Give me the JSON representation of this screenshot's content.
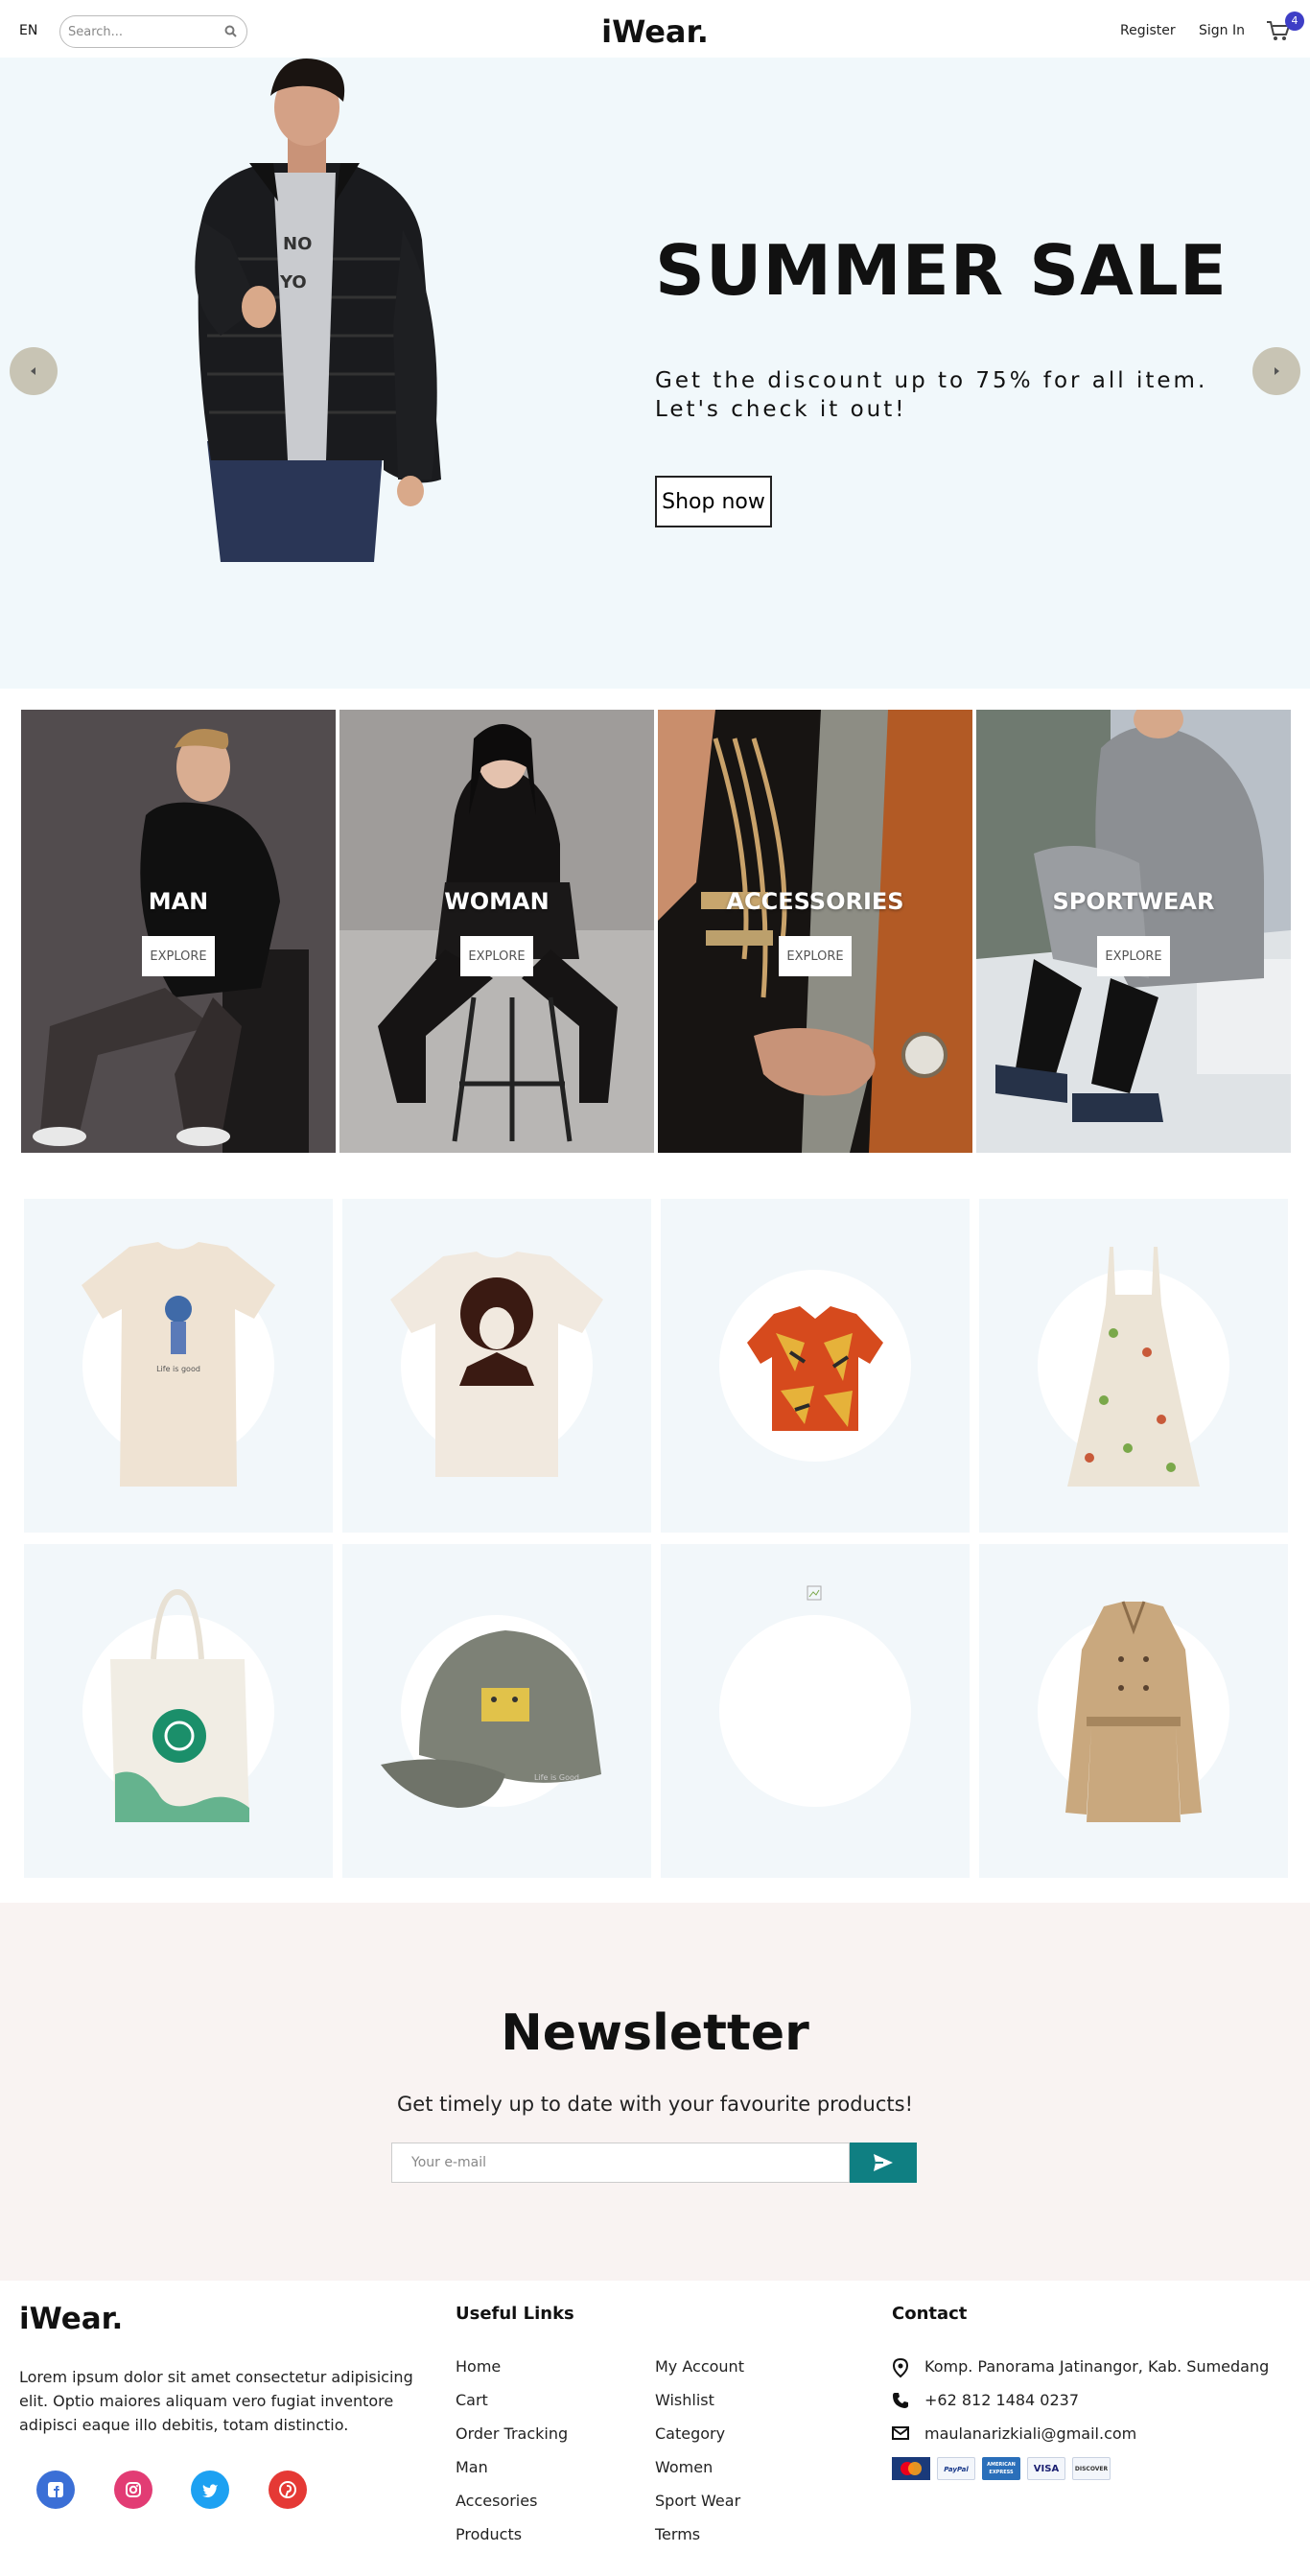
{
  "header": {
    "lang": "EN",
    "search_placeholder": "Search...",
    "logo": "iWear.",
    "register": "Register",
    "signin": "Sign In",
    "cart_count": "4"
  },
  "hero": {
    "title": "SUMMER SALE",
    "subtitle": "Get the discount up to 75% for all item. Let's check it out!",
    "button": "Shop now"
  },
  "categories": [
    {
      "label": "MAN",
      "button": "EXPLORE"
    },
    {
      "label": "WOMAN",
      "button": "EXPLORE"
    },
    {
      "label": "ACCESSORIES",
      "button": "EXPLORE"
    },
    {
      "label": "SPORTWEAR",
      "button": "EXPLORE"
    }
  ],
  "products": [
    "t-shirt-guitar",
    "t-shirt-portrait",
    "hawaiian-shirt",
    "floral-dress",
    "tote-bag",
    "cap",
    "broken-image",
    "trench-coat"
  ],
  "newsletter": {
    "title": "Newsletter",
    "subtitle": "Get timely up to date with your favourite products!",
    "placeholder": "Your e-mail"
  },
  "footer": {
    "logo": "iWear.",
    "description": "Lorem ipsum dolor sit amet consectetur adipisicing elit. Optio maiores aliquam vero fugiat inventore adipisci eaque illo debitis, totam distinctio.",
    "useful_links_title": "Useful Links",
    "links_col1": [
      "Home",
      "Cart",
      "Order Tracking",
      "Man",
      "Accesories",
      "Products"
    ],
    "links_col2": [
      "My Account",
      "Wishlist",
      "Category",
      "Women",
      "Sport Wear",
      "Terms"
    ],
    "contact_title": "Contact",
    "address": "Komp. Panorama Jatinangor, Kab. Sumedang",
    "phone": "+62 812 1484 0237",
    "email": "maulanarizkiali@gmail.com",
    "payments": [
      "MasterCard",
      "PayPal",
      "AMERICAN EXPRESS",
      "VISA",
      "DISCOVER"
    ],
    "social": [
      "facebook-icon",
      "instagram-icon",
      "twitter-icon",
      "pinterest-icon"
    ]
  },
  "colors": {
    "hero_bg": "#f1f8fb",
    "cart_badge": "#3e3ec6",
    "newsletter_bg": "#f9f3f2",
    "newsletter_button": "#0f7f82",
    "product_bg": "#f2f7fa"
  }
}
